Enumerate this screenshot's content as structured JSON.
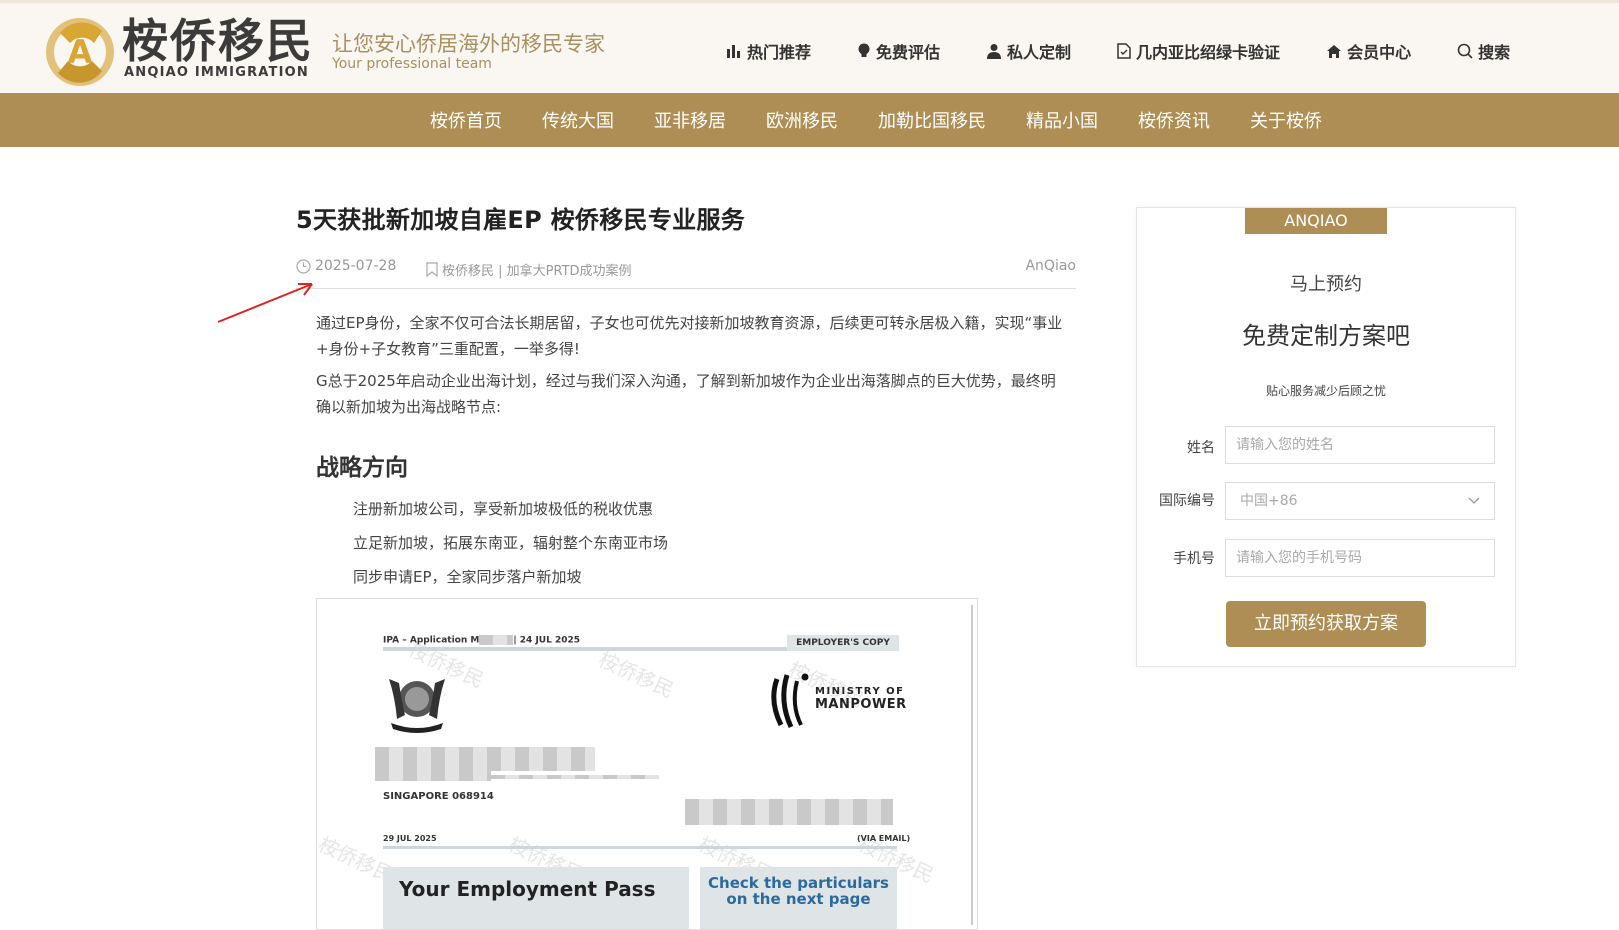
{
  "header": {
    "brand_cn": "桉侨移民",
    "brand_en": "ANQIAO IMMIGRATION",
    "slogan_cn": "让您安心侨居海外的移民专家",
    "slogan_en": "Your professional team",
    "top_nav": [
      {
        "label": "热门推荐",
        "icon": "bar-chart-icon"
      },
      {
        "label": "免费评估",
        "icon": "lightbulb-icon"
      },
      {
        "label": "私人定制",
        "icon": "user-icon"
      },
      {
        "label": "几内亚比绍绿卡验证",
        "icon": "document-icon"
      },
      {
        "label": "会员中心",
        "icon": "home-icon"
      },
      {
        "label": "搜索",
        "icon": "search-icon"
      }
    ]
  },
  "main_nav": [
    "桉侨首页",
    "传统大国",
    "亚非移居",
    "欧洲移民",
    "加勒比国移民",
    "精品小国",
    "桉侨资讯",
    "关于桉侨"
  ],
  "article": {
    "title": "5天获批新加坡自雇EP 桉侨移民专业服务",
    "date": "2025-07-28",
    "category": "桉侨移民 | 加拿大PRTD成功案例",
    "author": "AnQiao",
    "para1": "通过EP身份，全家不仅可合法长期居留，子女也可优先对接新加坡教育资源，后续更可转永居极入籍，实现“事业+身份+子女教育”三重配置，一举多得!",
    "para2": "G总于2025年启动企业出海计划，经过与我们深入沟通，了解到新加坡作为企业出海落脚点的巨大优势，最终明确以新加坡为出海战略节点:",
    "section_title": "战略方向",
    "points": [
      "注册新加坡公司，享受新加坡极低的税收优惠",
      "立足新加坡，拓展东南亚，辐射整个东南亚市场",
      "同步申请EP，全家同步落户新加坡"
    ]
  },
  "document": {
    "ipa": "IPA – Application M",
    "ipa_date": "| 24 JUL 2025",
    "employers_copy": "EMPLOYER'S COPY",
    "ministry_of": "MINISTRY OF",
    "manpower": "MANPOWER",
    "singapore": "SINGAPORE 068914",
    "date": "29 JUL 2025",
    "via_email": "(VIA EMAIL)",
    "your_ep": "Your Employment Pass",
    "check": "Check the particulars on the next page",
    "watermark": "桉侨移民"
  },
  "sidebar": {
    "badge": "ANQIAO",
    "subtitle": "马上预约",
    "headline": "免费定制方案吧",
    "tagline": "贴心服务减少后顾之忧",
    "name_label": "姓名",
    "name_placeholder": "请输入您的姓名",
    "code_label": "国际编号",
    "code_value": "中国+86",
    "phone_label": "手机号",
    "phone_placeholder": "请输入您的手机号码",
    "submit": "立即预约获取方案"
  },
  "colors": {
    "gold": "#ae8e55",
    "header_bg": "#faf7f2",
    "annotation": "#e0231f"
  }
}
